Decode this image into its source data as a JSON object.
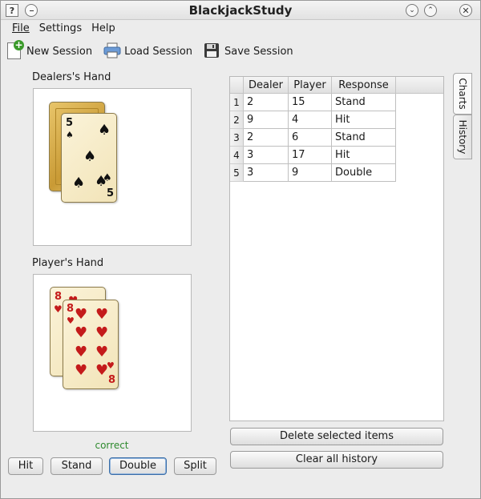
{
  "window": {
    "title": "BlackjackStudy",
    "help_glyph": "?",
    "min_glyph": "⌄",
    "max_glyph": "⌃",
    "close_glyph": "✕"
  },
  "menu": {
    "file": "File",
    "settings": "Settings",
    "help": "Help"
  },
  "toolbar": {
    "new_session": "New Session",
    "load_session": "Load Session",
    "save_session": "Save Session"
  },
  "dealer": {
    "label": "Dealers's Hand",
    "card": {
      "rank": "5",
      "suit": "♠"
    }
  },
  "player": {
    "label": "Player's Hand",
    "cards": [
      {
        "rank": "8",
        "suit": "♥"
      },
      {
        "rank": "8",
        "suit": "♥"
      }
    ]
  },
  "status": "correct",
  "actions": {
    "hit": "Hit",
    "stand": "Stand",
    "double": "Double",
    "split": "Split"
  },
  "history": {
    "columns": [
      "Dealer",
      "Player",
      "Response"
    ],
    "rows": [
      {
        "index": "1",
        "dealer": "2",
        "player": "15",
        "response": "Stand"
      },
      {
        "index": "2",
        "dealer": "9",
        "player": "4",
        "response": "Hit"
      },
      {
        "index": "3",
        "dealer": "2",
        "player": "6",
        "response": "Stand"
      },
      {
        "index": "4",
        "dealer": "3",
        "player": "17",
        "response": "Hit"
      },
      {
        "index": "5",
        "dealer": "3",
        "player": "9",
        "response": "Double"
      }
    ],
    "delete_button": "Delete selected items",
    "clear_button": "Clear all history"
  },
  "side_tabs": {
    "charts": "Charts",
    "history": "History"
  },
  "colors": {
    "status_correct": "#2e8a2e",
    "heart": "#c41b1b",
    "spade": "#111111"
  }
}
